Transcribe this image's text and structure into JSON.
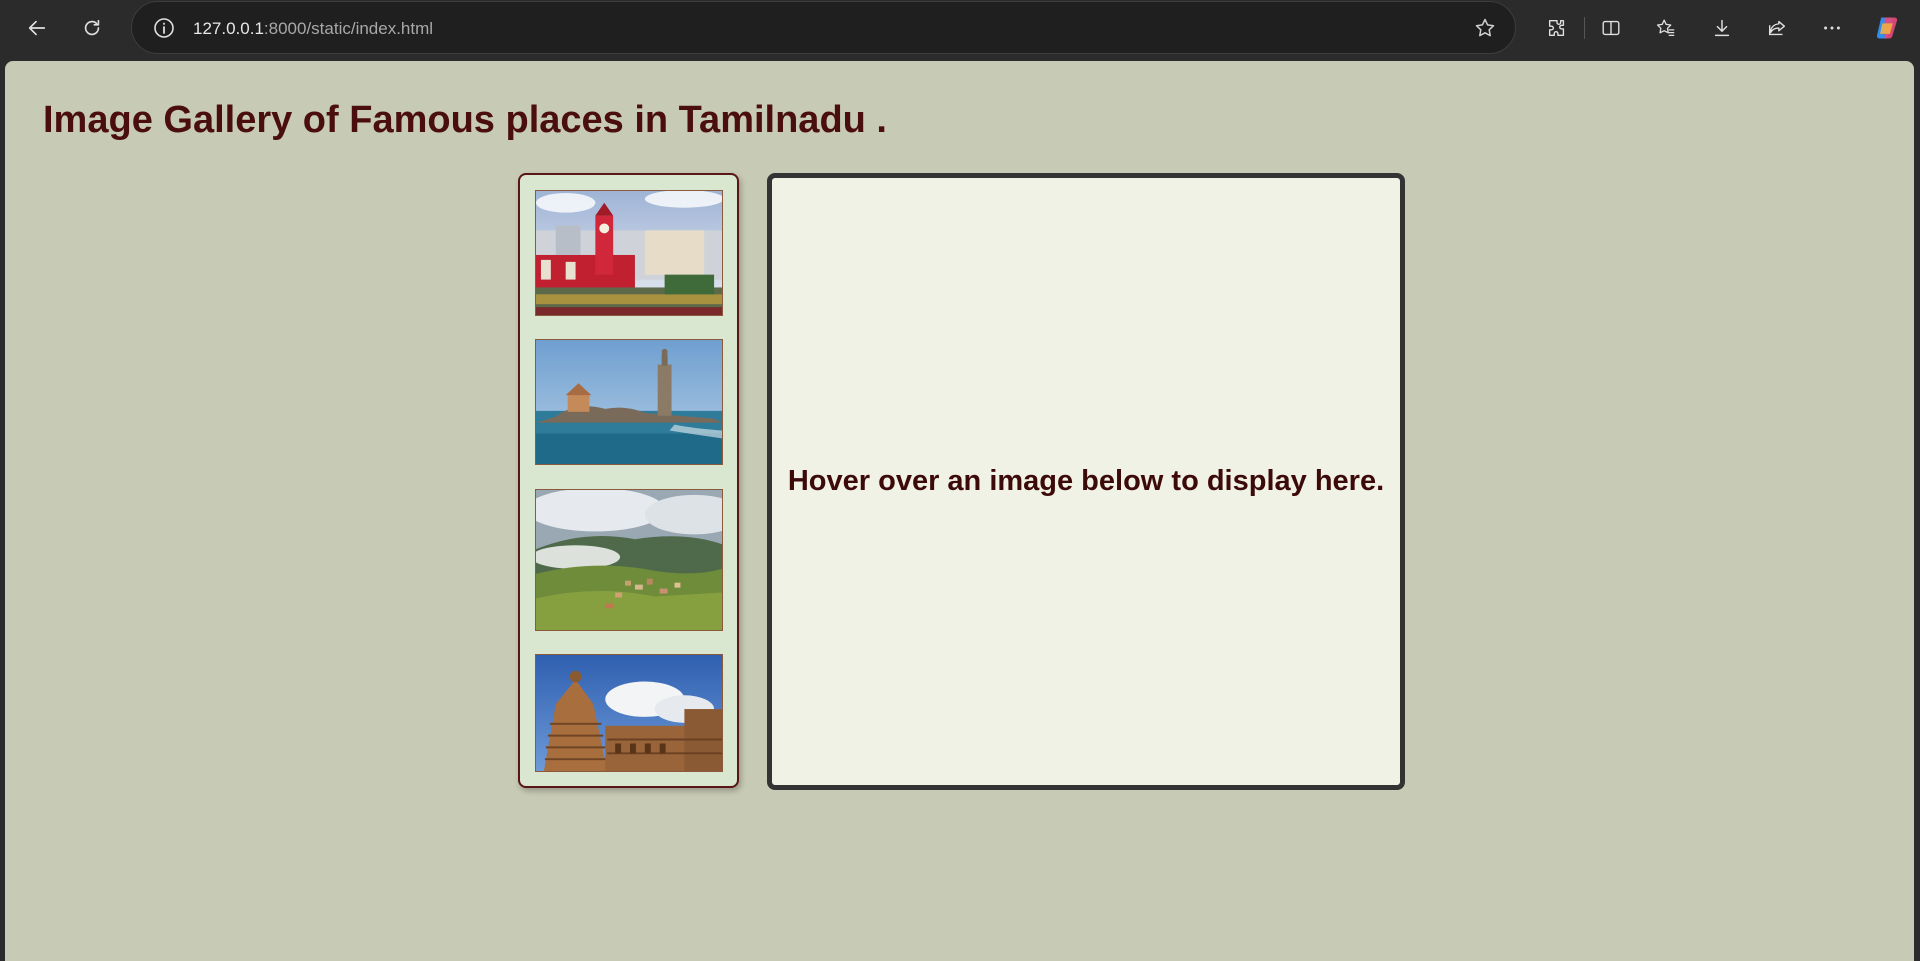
{
  "browser": {
    "url_host": "127.0.0.1",
    "url_rest": ":8000/static/index.html",
    "icons": [
      "back-icon",
      "reload-icon",
      "info-icon",
      "star-icon",
      "extensions-icon",
      "split-screen-icon",
      "favorites-icon",
      "download-icon",
      "share-icon",
      "more-icon",
      "copilot-icon"
    ]
  },
  "page": {
    "title": "Image Gallery of Famous places in Tamilnadu .",
    "display_text": "Hover over an image below to display here."
  },
  "gallery": {
    "thumbnails": [
      "chennai-central-image",
      "kanyakumari-vivekananda-rock-image",
      "hill-station-landscape-image",
      "thanjavur-temple-image"
    ]
  },
  "colors": {
    "page_bg": "#c7cab5",
    "title": "#4a0e0e",
    "thumb_panel_bg": "#d9e6d0",
    "thumb_panel_border": "#5a1515",
    "display_bg": "#f0f2e5",
    "display_border": "#333333"
  }
}
